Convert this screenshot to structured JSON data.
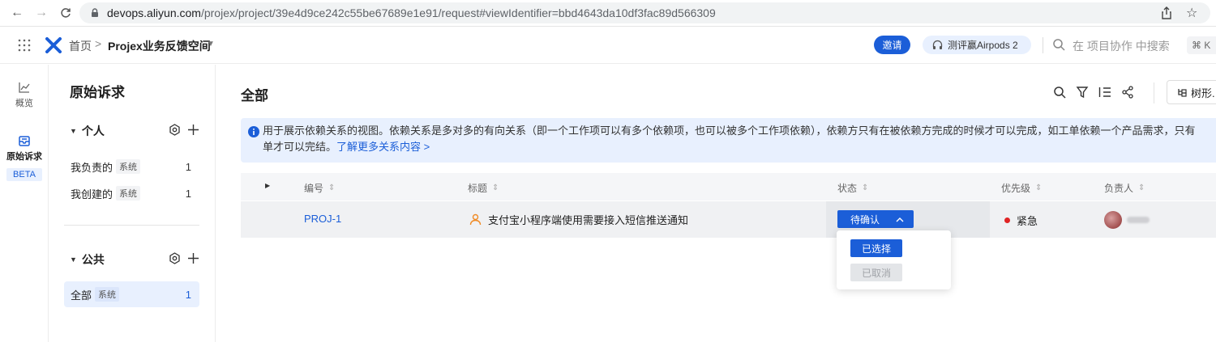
{
  "browser": {
    "url_host": "devops.aliyun.com",
    "url_path": "/projex/project/39e4d9ce242c55be67689e1e91/request#viewIdentifier=bbd4643da10df3fac89d566309"
  },
  "header": {
    "home": "首页",
    "separator": ">",
    "workspace": "Projex业务反馈空间",
    "invite": "邀请",
    "promo": "测评赢Airpods 2",
    "search_placeholder": "在 项目协作 中搜索",
    "shortcut": "⌘ K"
  },
  "rail": {
    "overview": "概览",
    "request": "原始诉求",
    "beta": "BETA"
  },
  "sidebar": {
    "title": "原始诉求",
    "personal": {
      "label": "个人",
      "items": [
        {
          "label": "我负责的",
          "tag": "系统",
          "count": "1"
        },
        {
          "label": "我创建的",
          "tag": "系统",
          "count": "1"
        }
      ]
    },
    "public": {
      "label": "公共",
      "items": [
        {
          "label": "全部",
          "tag": "系统",
          "count": "1"
        }
      ]
    }
  },
  "main": {
    "title": "全部",
    "view_mode": "树形.",
    "banner_text": "用于展示依赖关系的视图。依赖关系是多对多的有向关系（即一个工作项可以有多个依赖项，也可以被多个工作项依赖），依赖方只有在被依赖方完成的时候才可以完成，如工单依赖一个产品需求，只有",
    "banner_text2": "单才可以完结。",
    "banner_link": "了解更多关系内容 >",
    "columns": [
      "编号",
      "标题",
      "状态",
      "优先级",
      "负责人"
    ],
    "rows": [
      {
        "id": "PROJ-1",
        "title": "支付宝小程序端使用需要接入短信推送通知",
        "status": "待确认",
        "priority": "紧急"
      }
    ],
    "status_options": [
      "已选择",
      "已取消"
    ]
  },
  "colors": {
    "accent": "#1b5ed8",
    "banner_bg": "#e8f0fe",
    "urgent": "#e02424"
  }
}
